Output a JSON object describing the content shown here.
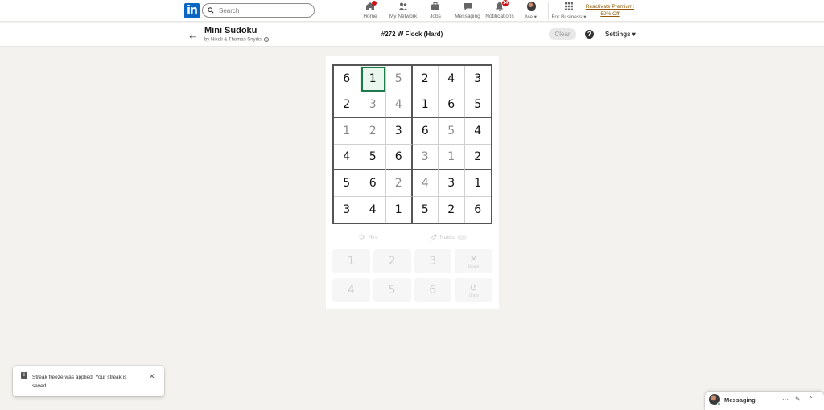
{
  "nav": {
    "logo_text": "in",
    "search_placeholder": "Search",
    "items": [
      {
        "label": "Home",
        "badge": ""
      },
      {
        "label": "My Network",
        "badge": ""
      },
      {
        "label": "Jobs",
        "badge": ""
      },
      {
        "label": "Messaging",
        "badge": ""
      },
      {
        "label": "Notifications",
        "badge": "14"
      },
      {
        "label": "Me",
        "badge": ""
      },
      {
        "label": "For Business",
        "badge": ""
      }
    ],
    "premium_line1": "Reactivate Premium:",
    "premium_line2": "50% Off"
  },
  "header": {
    "back_icon": "←",
    "title": "Mini Sudoku",
    "byline": "by Nikoli & Thomas Snyder",
    "puzzle_title": "#272 W Flock (Hard)",
    "clear_label": "Clear",
    "help_icon": "?",
    "settings_label": "Settings"
  },
  "grid": {
    "cells": [
      [
        "6",
        "1",
        "5",
        "2",
        "4",
        "3"
      ],
      [
        "2",
        "3",
        "4",
        "1",
        "6",
        "5"
      ],
      [
        "1",
        "2",
        "3",
        "6",
        "5",
        "4"
      ],
      [
        "4",
        "5",
        "6",
        "3",
        "1",
        "2"
      ],
      [
        "5",
        "6",
        "2",
        "4",
        "3",
        "1"
      ],
      [
        "3",
        "4",
        "1",
        "5",
        "2",
        "6"
      ]
    ],
    "user_entered": [
      [
        0,
        0,
        1,
        0,
        0,
        0
      ],
      [
        0,
        1,
        1,
        0,
        0,
        0
      ],
      [
        1,
        1,
        0,
        0,
        1,
        0
      ],
      [
        0,
        0,
        0,
        1,
        1,
        0
      ],
      [
        0,
        0,
        1,
        1,
        0,
        0
      ],
      [
        0,
        0,
        0,
        0,
        0,
        0
      ]
    ]
  },
  "tools": {
    "hint_label": "Hint",
    "notes_label": "Notes"
  },
  "keypad": {
    "keys": [
      "1",
      "2",
      "3",
      "4",
      "5",
      "6"
    ],
    "erase_label": "Erase",
    "undo_label": "Undo"
  },
  "toast": {
    "message": "Streak freeze was applied. Your streak is saved."
  },
  "messaging": {
    "label": "Messaging"
  }
}
